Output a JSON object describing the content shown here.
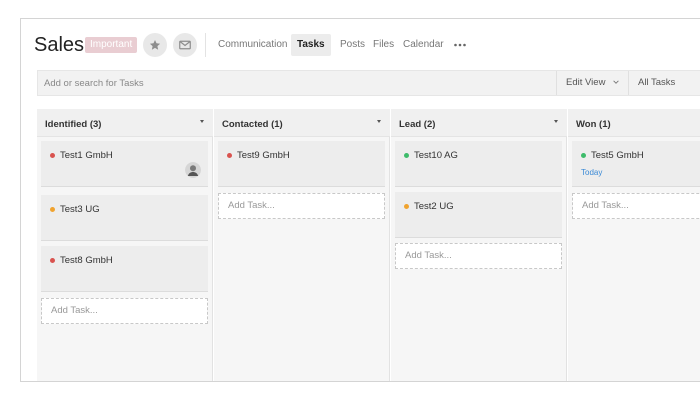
{
  "header": {
    "title": "Sales",
    "badge": "Important",
    "tabs": [
      {
        "label": "Communication",
        "active": false
      },
      {
        "label": "Tasks",
        "active": true
      },
      {
        "label": "Posts",
        "active": false
      },
      {
        "label": "Files",
        "active": false
      },
      {
        "label": "Calendar",
        "active": false
      }
    ],
    "icons": {
      "star": "star-icon",
      "mail": "mail-icon",
      "more": "more-icon"
    }
  },
  "toolbar": {
    "search_placeholder": "Add or search for Tasks",
    "edit_view_label": "Edit View",
    "all_tasks_label": "All Tasks"
  },
  "colors": {
    "red": "#d9534f",
    "orange": "#f0a32f",
    "green": "#3dbb6a",
    "link_blue": "#3b8ad6",
    "badge": "#e9cdd2"
  },
  "columns": [
    {
      "title": "Identified (3)",
      "cards": [
        {
          "title": "Test1 GmbH",
          "status_color": "#d9534f",
          "avatar": true
        },
        {
          "title": "Test3 UG",
          "status_color": "#f0a32f"
        },
        {
          "title": "Test8 GmbH",
          "status_color": "#d9534f"
        }
      ],
      "add_label": "Add Task..."
    },
    {
      "title": "Contacted (1)",
      "cards": [
        {
          "title": "Test9 GmbH",
          "status_color": "#d9534f"
        }
      ],
      "add_label": "Add Task..."
    },
    {
      "title": "Lead (2)",
      "cards": [
        {
          "title": "Test10 AG",
          "status_color": "#3dbb6a"
        },
        {
          "title": "Test2 UG",
          "status_color": "#f0a32f"
        }
      ],
      "add_label": "Add Task..."
    },
    {
      "title": "Won (1)",
      "cards": [
        {
          "title": "Test5 GmbH",
          "status_color": "#3dbb6a",
          "date": "Today"
        }
      ],
      "add_label": "Add Task..."
    }
  ]
}
